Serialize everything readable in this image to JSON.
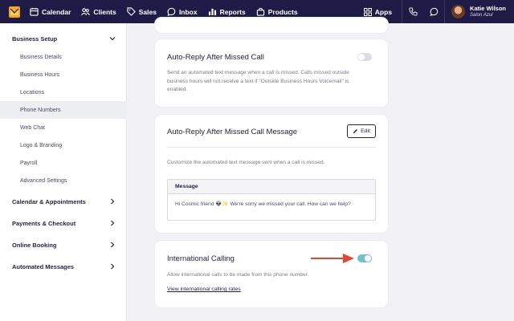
{
  "nav": {
    "items": [
      {
        "label": "Calendar",
        "icon": "calendar-icon"
      },
      {
        "label": "Clients",
        "icon": "clients-icon"
      },
      {
        "label": "Sales",
        "icon": "sales-tag-icon"
      },
      {
        "label": "Inbox",
        "icon": "inbox-icon"
      },
      {
        "label": "Reports",
        "icon": "reports-icon"
      },
      {
        "label": "Products",
        "icon": "products-bag-icon"
      }
    ],
    "apps_label": "Apps",
    "user": {
      "name": "Katie Wilson",
      "business": "Salon Azul"
    }
  },
  "sidebar": {
    "sections": [
      {
        "label": "Business Setup",
        "expanded": true
      },
      {
        "label": "Calendar & Appointments"
      },
      {
        "label": "Payments & Checkout"
      },
      {
        "label": "Online Booking"
      },
      {
        "label": "Automated Messages"
      }
    ],
    "items": [
      {
        "label": "Business Details"
      },
      {
        "label": "Business Hours"
      },
      {
        "label": "Locations"
      },
      {
        "label": "Phone Numbers",
        "active": true
      },
      {
        "label": "Web Chat"
      },
      {
        "label": "Logo & Branding"
      },
      {
        "label": "Payroll"
      },
      {
        "label": "Advanced Settings"
      }
    ]
  },
  "cards": {
    "auto_reply": {
      "title": "Auto-Reply After Missed Call",
      "desc_1": "Send an automated text message when a call is missed. Calls missed outside",
      "desc_2": "business hours will not receive a text if \"Outside Business Hours Voicemail\" is",
      "desc_3": "enabled.",
      "enabled": false
    },
    "auto_reply_message": {
      "title": "Auto-Reply After Missed Call Message",
      "edit_label": "Edit",
      "desc": "Customize the automated text message sent when a call is missed.",
      "message_header": "Message",
      "message_body": "Hi Cosmic friend 👽✨ We're sorry we missed your call. How can we help?"
    },
    "international": {
      "title": "International Calling",
      "desc": "Allow international calls to be made from this phone number.",
      "link": "View international calling rates",
      "enabled": true
    }
  },
  "colors": {
    "nav_bg": "#1e1b46",
    "toggle_on": "#6ec3cf",
    "arrow": "#e8452f"
  }
}
